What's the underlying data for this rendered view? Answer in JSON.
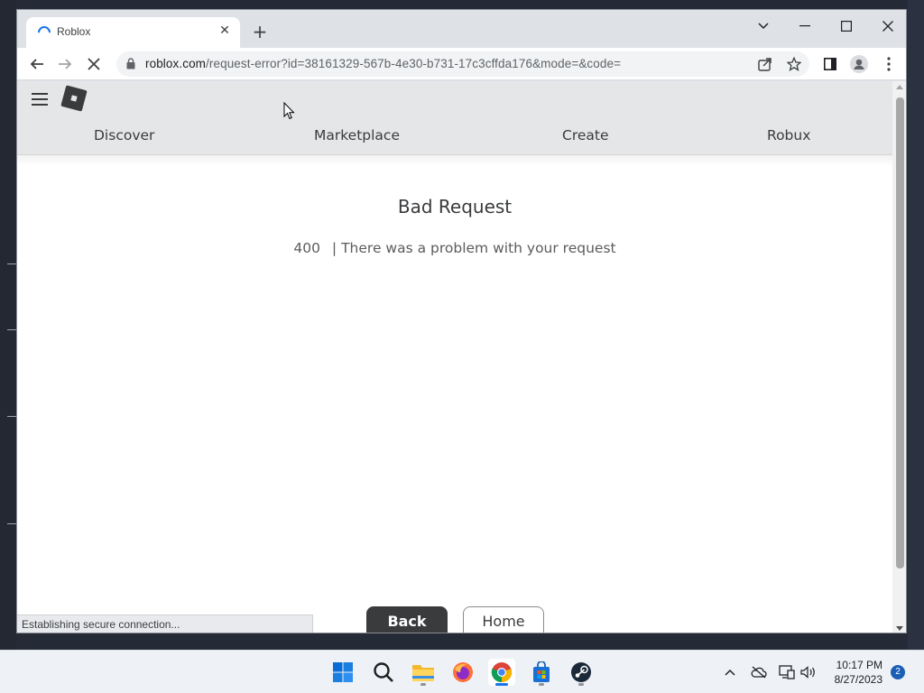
{
  "browser": {
    "tab": {
      "title": "Roblox",
      "close_glyph": "✕"
    },
    "new_tab_glyph": "+",
    "url": {
      "host": "roblox.com",
      "path": "/request-error?id=38161329-567b-4e30-b731-17c3cffda176&mode=&code="
    },
    "status_text": "Establishing secure connection...",
    "loading": true
  },
  "header": {
    "nav": [
      {
        "label": "Discover"
      },
      {
        "label": "Marketplace"
      },
      {
        "label": "Create"
      },
      {
        "label": "Robux"
      }
    ]
  },
  "error": {
    "title": "Bad Request",
    "code": "400",
    "separator": "|",
    "message": "There was a problem with your request"
  },
  "buttons": {
    "back": "Back",
    "home": "Home"
  },
  "taskbar": {
    "apps": [
      "start-icon",
      "search-icon",
      "file-explorer-icon",
      "firefox-icon",
      "chrome-icon",
      "microsoft-store-icon",
      "steam-icon"
    ],
    "active_app": "chrome-icon",
    "time": "10:17 PM",
    "date": "8/27/2023",
    "notifications": "2"
  },
  "colors": {
    "header_bg": "#e5e6e8",
    "primary_button": "#393b3d",
    "accent": "#1a73e8"
  }
}
